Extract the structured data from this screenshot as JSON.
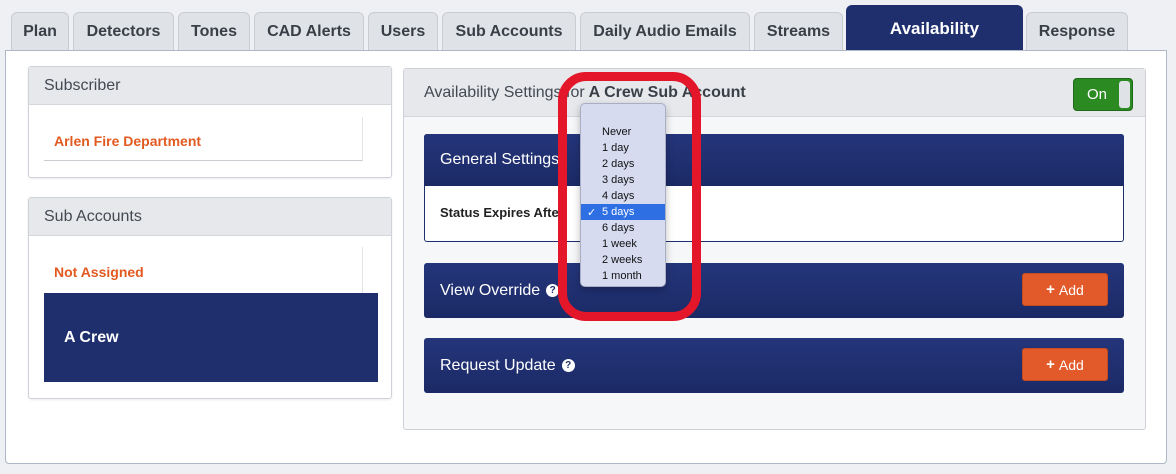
{
  "tabs": [
    {
      "label": "Plan"
    },
    {
      "label": "Detectors"
    },
    {
      "label": "Tones"
    },
    {
      "label": "CAD Alerts"
    },
    {
      "label": "Users"
    },
    {
      "label": "Sub Accounts"
    },
    {
      "label": "Daily Audio Emails"
    },
    {
      "label": "Streams"
    },
    {
      "label": "Availability"
    },
    {
      "label": "Response"
    }
  ],
  "subscriber": {
    "title": "Subscriber",
    "name": "Arlen Fire Department"
  },
  "sub_accounts": {
    "title": "Sub Accounts",
    "items": [
      {
        "label": "Not Assigned"
      },
      {
        "label": "A Crew"
      }
    ]
  },
  "availability": {
    "heading_prefix": "Availability Settings for",
    "account_name": "A Crew Sub Account",
    "toggle_label": "On",
    "general_settings": "General Settings",
    "status_expires_label": "Status Expires After",
    "view_override": "View Override",
    "request_update": "Request Update",
    "add_label": "Add"
  },
  "expire_dropdown": {
    "selected": "5 days",
    "options": [
      "Never",
      "1 day",
      "2 days",
      "3 days",
      "4 days",
      "5 days",
      "6 days",
      "1 week",
      "2 weeks",
      "1 month"
    ]
  },
  "colors": {
    "navy": "#1f2f6e",
    "accent_orange": "#e2592a",
    "toggle_green": "#2b8a22",
    "highlight_red": "#e4172a"
  }
}
